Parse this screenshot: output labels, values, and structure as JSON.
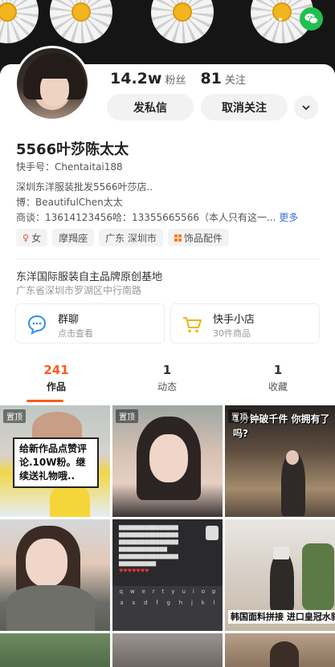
{
  "profile": {
    "followers_count": "14.2w",
    "followers_label": "粉丝",
    "following_count": "81",
    "following_label": "关注",
    "message_button": "发私信",
    "unfollow_button": "取消关注",
    "nickname": "5566叶莎陈太太",
    "kuaishou_id": "快手号：Chentaitai188",
    "bio_line1": "深圳东洋服装批发5566叶莎店..",
    "bio_line2": "博：BeautifulChen太太",
    "bio_line3": "商谈：13614123456哈：13355665566（本人只有这一...",
    "bio_more": "更多"
  },
  "tags": [
    {
      "icon": "female-icon",
      "label": "女"
    },
    {
      "icon": "",
      "label": "摩羯座"
    },
    {
      "icon": "",
      "label": "广东 深圳市"
    },
    {
      "icon": "category-icon",
      "label": "饰品配件"
    }
  ],
  "business": {
    "name": "东洋国际服装自主品牌原创基地",
    "address": "广东省深圳市罗湖区中行南路"
  },
  "cards": {
    "group_title": "群聊",
    "group_sub": "点击查看",
    "shop_title": "快手小店",
    "shop_sub": "30件商品"
  },
  "tabs": [
    {
      "count": "241",
      "label": "作品",
      "active": true
    },
    {
      "count": "1",
      "label": "动态",
      "active": false
    },
    {
      "count": "1",
      "label": "收藏",
      "active": false
    }
  ],
  "grid": {
    "pin_label": "置顶",
    "c1_caption": "给新作品点赞评论.10W粉。继续送礼物哦..",
    "c3_caption": "1分钟破千件 你拥有了吗?",
    "c6_caption": "韩国面料拼接 进口皇冠水貂"
  },
  "colors": {
    "accent": "#ff5a1f",
    "link": "#3a6fd8",
    "wechat": "#20c050"
  }
}
